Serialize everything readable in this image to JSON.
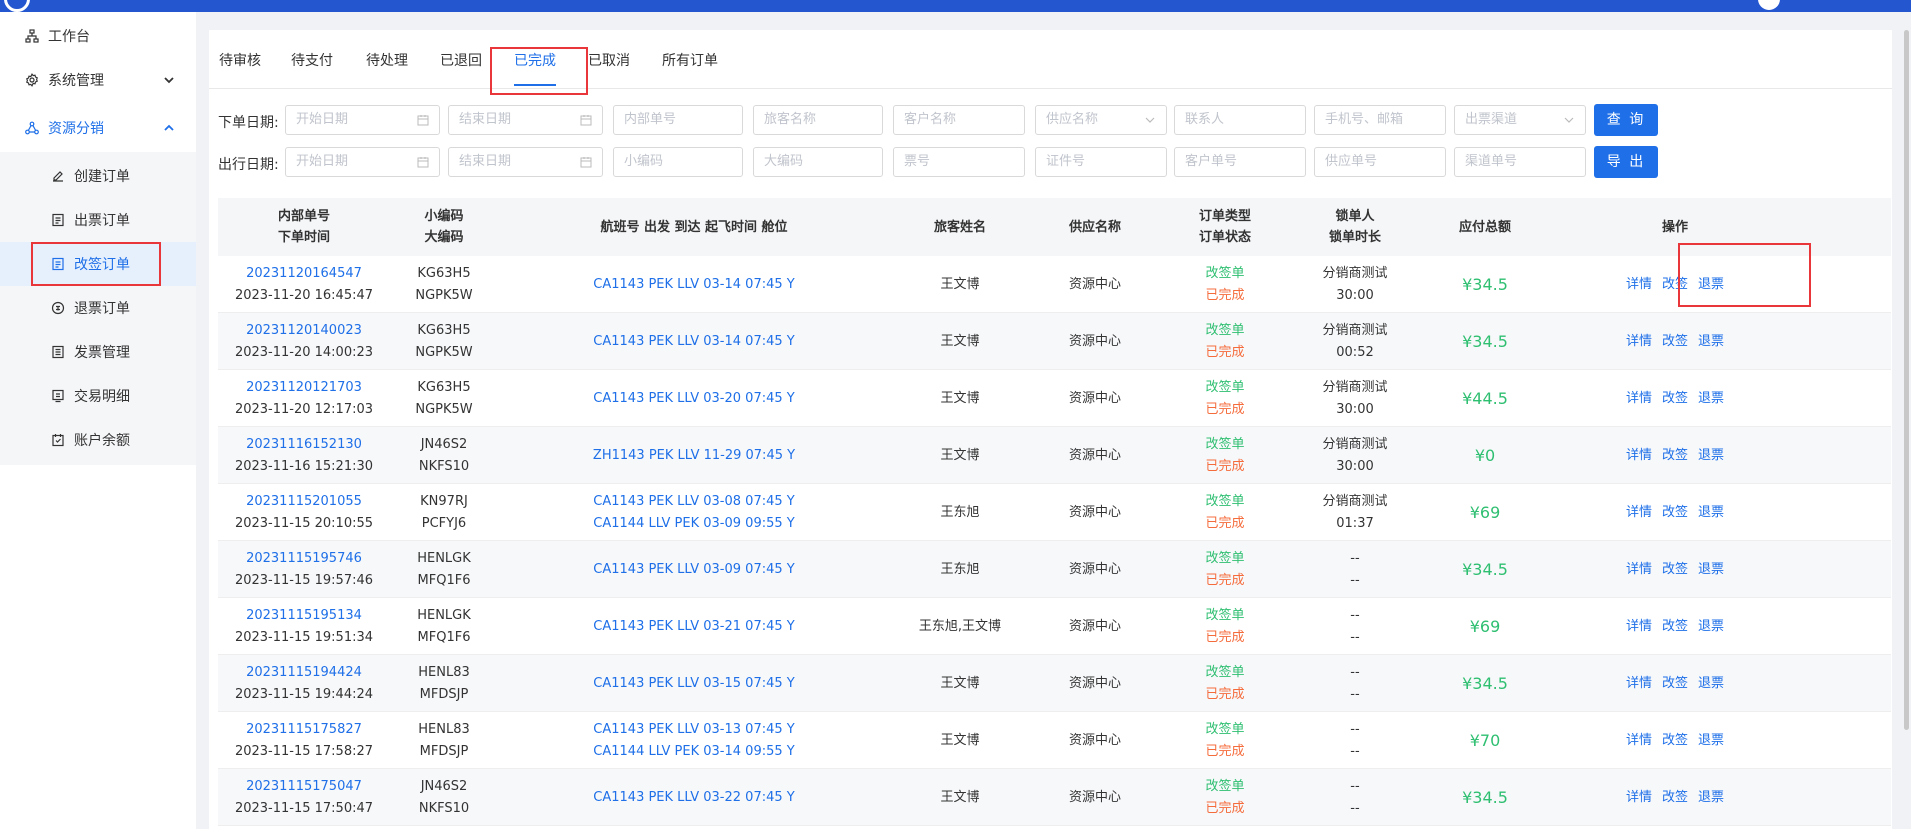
{
  "sidebar": {
    "top_items": [
      {
        "label": "工作台",
        "icon": "sitemap-icon"
      },
      {
        "label": "系统管理",
        "icon": "gear-icon"
      },
      {
        "label": "资源分销",
        "icon": "share-icon"
      }
    ],
    "sub_items": [
      {
        "label": "创建订单",
        "icon": "edit-icon"
      },
      {
        "label": "出票订单",
        "icon": "document-icon"
      },
      {
        "label": "改签订单",
        "icon": "document-icon"
      },
      {
        "label": "退票订单",
        "icon": "refund-icon"
      },
      {
        "label": "发票管理",
        "icon": "invoice-icon"
      },
      {
        "label": "交易明细",
        "icon": "transaction-icon"
      },
      {
        "label": "账户余额",
        "icon": "wallet-icon"
      }
    ]
  },
  "tabs": [
    "待审核",
    "待支付",
    "待处理",
    "已退回",
    "已完成",
    "已取消",
    "所有订单"
  ],
  "active_tab": "已完成",
  "filters": {
    "row1_label": "下单日期:",
    "row2_label": "出行日期:",
    "start_date": "开始日期",
    "end_date": "结束日期",
    "row1": [
      "内部单号",
      "旅客名称",
      "客户名称",
      "供应名称",
      "联系人",
      "手机号、邮箱",
      "出票渠道"
    ],
    "row2": [
      "小编码",
      "大编码",
      "票号",
      "证件号",
      "客户单号",
      "供应单号",
      "渠道单号"
    ],
    "search_button": "查 询",
    "export_button": "导 出"
  },
  "table": {
    "headers": {
      "order": [
        "内部单号",
        "下单时间"
      ],
      "codes": [
        "小编码",
        "大编码"
      ],
      "flight": "航班号 出发 到达 起飞时间 舱位",
      "passenger": "旅客姓名",
      "supplier": "供应名称",
      "type": [
        "订单类型",
        "订单状态"
      ],
      "lock": [
        "锁单人",
        "锁单时长"
      ],
      "amount": "应付总额",
      "actions": "操作"
    },
    "rows": [
      {
        "id": "20231120164547",
        "time": "2023-11-20 16:45:47",
        "small": "KG63H5",
        "big": "NGPK5W",
        "flights": [
          "CA1143 PEK LLV 03-14 07:45 Y"
        ],
        "passenger": "王文博",
        "supplier": "资源中心",
        "type": "改签单",
        "status": "已完成",
        "locker": "分销商测试",
        "duration": "30:00",
        "amount": "¥34.5"
      },
      {
        "id": "20231120140023",
        "time": "2023-11-20 14:00:23",
        "small": "KG63H5",
        "big": "NGPK5W",
        "flights": [
          "CA1143 PEK LLV 03-14 07:45 Y"
        ],
        "passenger": "王文博",
        "supplier": "资源中心",
        "type": "改签单",
        "status": "已完成",
        "locker": "分销商测试",
        "duration": "00:52",
        "amount": "¥34.5"
      },
      {
        "id": "20231120121703",
        "time": "2023-11-20 12:17:03",
        "small": "KG63H5",
        "big": "NGPK5W",
        "flights": [
          "CA1143 PEK LLV 03-20 07:45 Y"
        ],
        "passenger": "王文博",
        "supplier": "资源中心",
        "type": "改签单",
        "status": "已完成",
        "locker": "分销商测试",
        "duration": "30:00",
        "amount": "¥44.5"
      },
      {
        "id": "20231116152130",
        "time": "2023-11-16 15:21:30",
        "small": "JN46S2",
        "big": "NKFS10",
        "flights": [
          "ZH1143 PEK LLV 11-29 07:45 Y"
        ],
        "passenger": "王文博",
        "supplier": "资源中心",
        "type": "改签单",
        "status": "已完成",
        "locker": "分销商测试",
        "duration": "30:00",
        "amount": "¥0"
      },
      {
        "id": "20231115201055",
        "time": "2023-11-15 20:10:55",
        "small": "KN97RJ",
        "big": "PCFYJ6",
        "flights": [
          "CA1143 PEK LLV 03-08 07:45 Y",
          "CA1144 LLV PEK 03-09 09:55 Y"
        ],
        "passenger": "王东旭",
        "supplier": "资源中心",
        "type": "改签单",
        "status": "已完成",
        "locker": "分销商测试",
        "duration": "01:37",
        "amount": "¥69"
      },
      {
        "id": "20231115195746",
        "time": "2023-11-15 19:57:46",
        "small": "HENLGK",
        "big": "MFQ1F6",
        "flights": [
          "CA1143 PEK LLV 03-09 07:45 Y"
        ],
        "passenger": "王东旭",
        "supplier": "资源中心",
        "type": "改签单",
        "status": "已完成",
        "locker": "--",
        "duration": "--",
        "amount": "¥34.5"
      },
      {
        "id": "20231115195134",
        "time": "2023-11-15 19:51:34",
        "small": "HENLGK",
        "big": "MFQ1F6",
        "flights": [
          "CA1143 PEK LLV 03-21 07:45 Y"
        ],
        "passenger": "王东旭,王文博",
        "supplier": "资源中心",
        "type": "改签单",
        "status": "已完成",
        "locker": "--",
        "duration": "--",
        "amount": "¥69"
      },
      {
        "id": "20231115194424",
        "time": "2023-11-15 19:44:24",
        "small": "HENL83",
        "big": "MFDSJP",
        "flights": [
          "CA1143 PEK LLV 03-15 07:45 Y"
        ],
        "passenger": "王文博",
        "supplier": "资源中心",
        "type": "改签单",
        "status": "已完成",
        "locker": "--",
        "duration": "--",
        "amount": "¥34.5"
      },
      {
        "id": "20231115175827",
        "time": "2023-11-15 17:58:27",
        "small": "HENL83",
        "big": "MFDSJP",
        "flights": [
          "CA1143 PEK LLV 03-13 07:45 Y",
          "CA1144 LLV PEK 03-14 09:55 Y"
        ],
        "passenger": "王文博",
        "supplier": "资源中心",
        "type": "改签单",
        "status": "已完成",
        "locker": "--",
        "duration": "--",
        "amount": "¥70"
      },
      {
        "id": "20231115175047",
        "time": "2023-11-15 17:50:47",
        "small": "JN46S2",
        "big": "NKFS10",
        "flights": [
          "CA1143 PEK LLV 03-22 07:45 Y"
        ],
        "passenger": "王文博",
        "supplier": "资源中心",
        "type": "改签单",
        "status": "已完成",
        "locker": "--",
        "duration": "--",
        "amount": "¥34.5"
      }
    ],
    "actions": [
      "详情",
      "改签",
      "退票"
    ]
  },
  "colors": {
    "primary": "#1e6fe8",
    "header_bar": "#2456cf",
    "success": "#2fbf71",
    "status": "#f56c3c",
    "highlight_box": "#e8363a"
  }
}
